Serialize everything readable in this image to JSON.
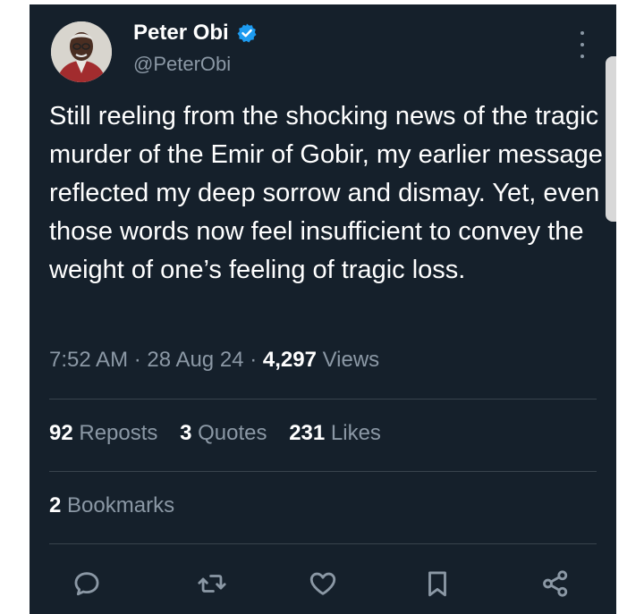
{
  "author": {
    "name": "Peter Obi",
    "handle": "@PeterObi"
  },
  "tweet": {
    "text": "Still reeling from the shocking news of the tragic murder of the Emir of Gobir, my earlier message reflected my deep sorrow and dismay. Yet, even those words now feel insufficient to convey the weight of one’s feeling of tragic loss."
  },
  "meta": {
    "time": "7:52 AM",
    "separator": "·",
    "date": "28 Aug 24",
    "views_count": "4,297",
    "views_label": "Views"
  },
  "stats": {
    "reposts_count": "92",
    "reposts_label": "Reposts",
    "quotes_count": "3",
    "quotes_label": "Quotes",
    "likes_count": "231",
    "likes_label": "Likes",
    "bookmarks_count": "2",
    "bookmarks_label": "Bookmarks"
  },
  "icons": {
    "more": "more-vertical-icon",
    "reply": "reply-icon",
    "repost": "repost-icon",
    "like": "like-icon",
    "bookmark": "bookmark-icon",
    "share": "share-icon"
  },
  "colors": {
    "background": "#15202b",
    "text": "#ffffff",
    "secondary_text": "#8b98a5",
    "verified": "#1d9bf0",
    "divider": "#38444d"
  }
}
